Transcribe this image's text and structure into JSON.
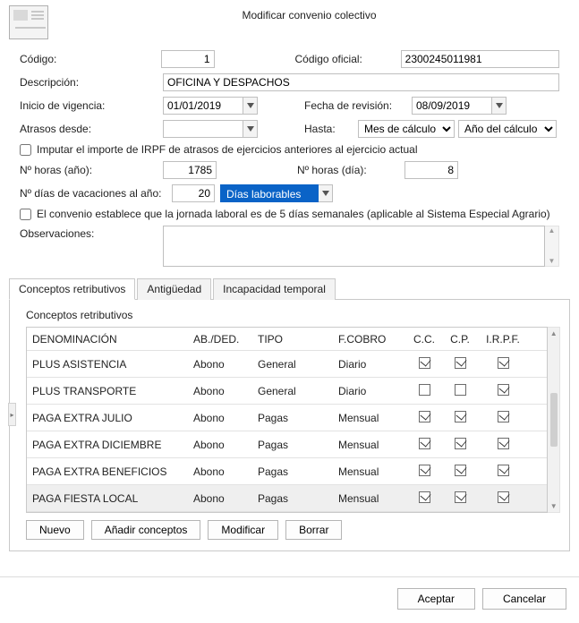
{
  "title": "Modificar convenio colectivo",
  "labels": {
    "codigo": "Código:",
    "codigo_oficial": "Código oficial:",
    "descripcion": "Descripción:",
    "inicio_vigencia": "Inicio de vigencia:",
    "fecha_revision": "Fecha de revisión:",
    "atrasos_desde": "Atrasos desde:",
    "hasta": "Hasta:",
    "imputar": "Imputar el importe de IRPF de atrasos de ejercicios anteriores al ejercicio actual",
    "n_horas_ano": "Nº horas (año):",
    "n_horas_dia": "Nº horas (día):",
    "n_dias_vac": "Nº días de vacaciones al año:",
    "convenio_5dias": "El convenio establece que la jornada laboral es de 5 días semanales (aplicable al Sistema Especial Agrario)",
    "observaciones": "Observaciones:",
    "vac_tipo": "Días laborables",
    "hasta_mes": "Mes de cálculo",
    "hasta_ano": "Año del cálculo d"
  },
  "values": {
    "codigo": "1",
    "codigo_oficial": "2300245011981",
    "descripcion": "OFICINA Y DESPACHOS",
    "inicio_vigencia": "01/01/2019",
    "fecha_revision": "08/09/2019",
    "atrasos_desde": "",
    "n_horas_ano": "1785",
    "n_horas_dia": "8",
    "n_dias_vac": "20",
    "observaciones": ""
  },
  "checks": {
    "imputar": false,
    "convenio_5dias": false
  },
  "tabs": {
    "t1": "Conceptos retributivos",
    "t2": "Antigüedad",
    "t3": "Incapacidad temporal"
  },
  "grid": {
    "title": "Conceptos retributivos",
    "headers": {
      "den": "DENOMINACIÓN",
      "ab": "AB./DED.",
      "tipo": "TIPO",
      "fc": "F.COBRO",
      "cc": "C.C.",
      "cp": "C.P.",
      "irpf": "I.R.P.F."
    },
    "rows": [
      {
        "den": "PLUS ASISTENCIA",
        "ab": "Abono",
        "tipo": "General",
        "fc": "Diario",
        "cc": true,
        "cp": true,
        "irpf": true,
        "sel": false
      },
      {
        "den": "PLUS TRANSPORTE",
        "ab": "Abono",
        "tipo": "General",
        "fc": "Diario",
        "cc": false,
        "cp": false,
        "irpf": true,
        "sel": false
      },
      {
        "den": "PAGA EXTRA JULIO",
        "ab": "Abono",
        "tipo": "Pagas",
        "fc": "Mensual",
        "cc": true,
        "cp": true,
        "irpf": true,
        "sel": false
      },
      {
        "den": "PAGA EXTRA DICIEMBRE",
        "ab": "Abono",
        "tipo": "Pagas",
        "fc": "Mensual",
        "cc": true,
        "cp": true,
        "irpf": true,
        "sel": false
      },
      {
        "den": "PAGA EXTRA BENEFICIOS",
        "ab": "Abono",
        "tipo": "Pagas",
        "fc": "Mensual",
        "cc": true,
        "cp": true,
        "irpf": true,
        "sel": false
      },
      {
        "den": "PAGA FIESTA LOCAL",
        "ab": "Abono",
        "tipo": "Pagas",
        "fc": "Mensual",
        "cc": true,
        "cp": true,
        "irpf": true,
        "sel": true
      }
    ]
  },
  "buttons": {
    "nuevo": "Nuevo",
    "anadir": "Añadir conceptos",
    "modificar": "Modificar",
    "borrar": "Borrar",
    "aceptar": "Aceptar",
    "cancelar": "Cancelar"
  }
}
